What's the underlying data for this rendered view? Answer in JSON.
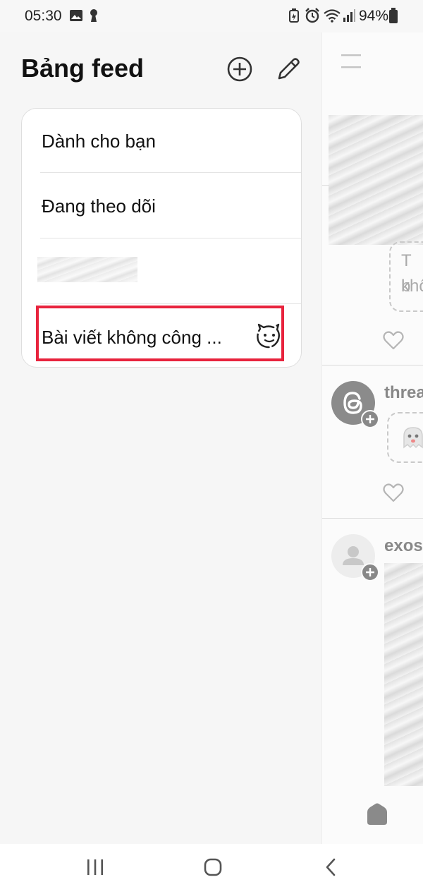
{
  "status_bar": {
    "time": "05:30",
    "battery_percent": "94%",
    "icons": [
      "image-icon",
      "keyhole-icon",
      "battery-saver-icon",
      "alarm-icon",
      "wifi-icon",
      "signal-icon",
      "battery-icon"
    ]
  },
  "drawer": {
    "title": "Bảng feed",
    "actions": [
      {
        "name": "add-feed-button",
        "icon": "plus-circle-icon"
      },
      {
        "name": "edit-feeds-button",
        "icon": "pencil-icon"
      }
    ],
    "items": [
      {
        "label": "Dành cho bạn"
      },
      {
        "label": "Đang theo dõi"
      },
      {
        "label": ""
      },
      {
        "label": "Bài viết không công ...",
        "icon": "private-profile-icon",
        "highlighted": true
      }
    ],
    "highlight_color": "#e8233d"
  },
  "feed_panel": {
    "menu_icon": "hamburger-menu-icon",
    "post1": {
      "bubble_text_line1": "T b",
      "bubble_text_line2": "khô"
    },
    "post2": {
      "username": "threa",
      "avatar_icon": "threads-logo-icon"
    },
    "post3": {
      "username": "exos",
      "avatar_icon": "person-icon"
    },
    "home_icon": "home-icon"
  },
  "nav_bar": {
    "buttons": [
      {
        "name": "recents-button",
        "icon": "recents-icon"
      },
      {
        "name": "home-button",
        "icon": "home-circle-icon"
      },
      {
        "name": "back-button",
        "icon": "back-chevron-icon"
      }
    ]
  }
}
